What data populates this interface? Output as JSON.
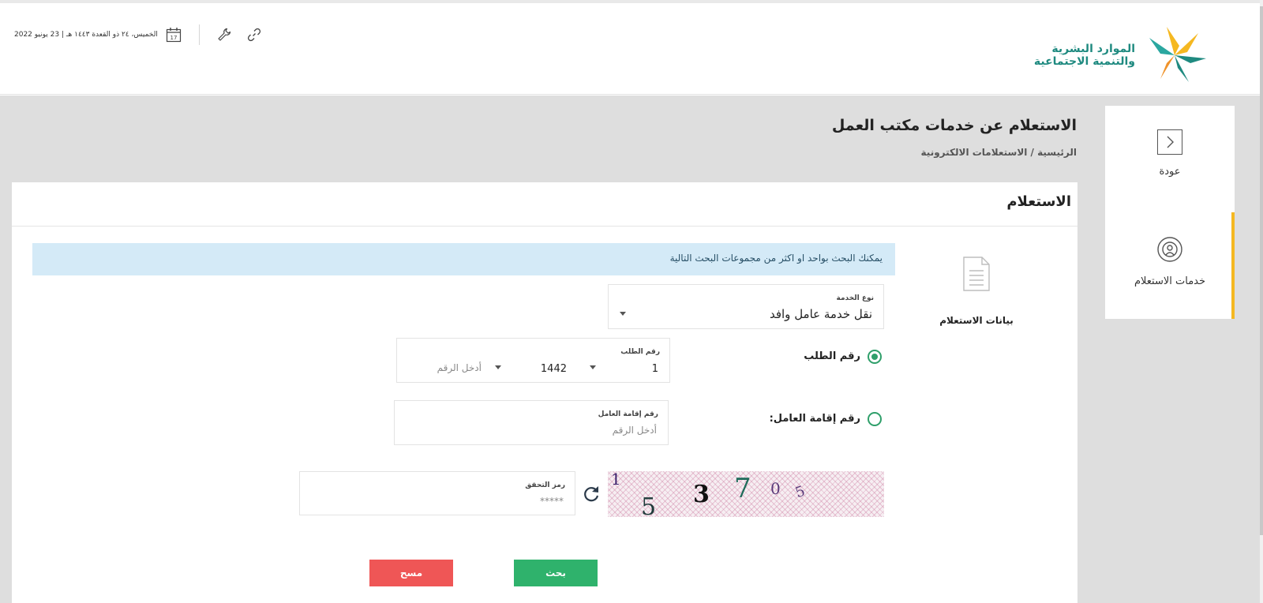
{
  "header": {
    "logo": {
      "line1": "الموارد البشرية",
      "line2": "والتنمية الاجتماعية"
    },
    "date_text": "الخميس، ٢٤ ذو القعدة ١٤٤٣ هـ | 23 يونيو 2022",
    "calendar_day": "17"
  },
  "sidebar": {
    "items": [
      {
        "label": "عودة",
        "icon": "chevron-right-icon"
      },
      {
        "label": "خدمات الاستعلام",
        "icon": "inquiry-services-icon",
        "active": true
      }
    ]
  },
  "page": {
    "title": "الاستعلام عن خدمات مكتب العمل",
    "breadcrumb": "الرئيسية / الاستعلامات الالكترونية"
  },
  "card": {
    "title": "الاستعلام",
    "section_label": "بيانات الاستعلام",
    "info_text": "يمكنك البحث بواحد او اكثر من مجموعات البحث التالية"
  },
  "form": {
    "service_type": {
      "label": "نوع الخدمة",
      "value": "نقل خدمة عامل وافد"
    },
    "request_option": {
      "label": "رقم الطلب",
      "selected": true
    },
    "request_number": {
      "label": "رقم الطلب",
      "prefix": "1",
      "year": "1442",
      "placeholder": "أدخل الرقم"
    },
    "iqama_option": {
      "label": "رقم إقامة العامل:",
      "selected": false
    },
    "iqama_number": {
      "label": "رقم إقامة العامل",
      "placeholder": "أدخل الرقم"
    },
    "captcha": {
      "label": "رمز التحقق",
      "placeholder": "*****",
      "glyphs": [
        "1",
        "5",
        "3",
        "7",
        "0",
        "5"
      ]
    }
  },
  "buttons": {
    "search": "بحث",
    "clear": "مسح"
  },
  "colors": {
    "brand": "#1f8a80",
    "accent": "#f5b821",
    "search": "#2fb26c",
    "clear": "#ef5656",
    "info_bg": "#d4eaf7"
  }
}
